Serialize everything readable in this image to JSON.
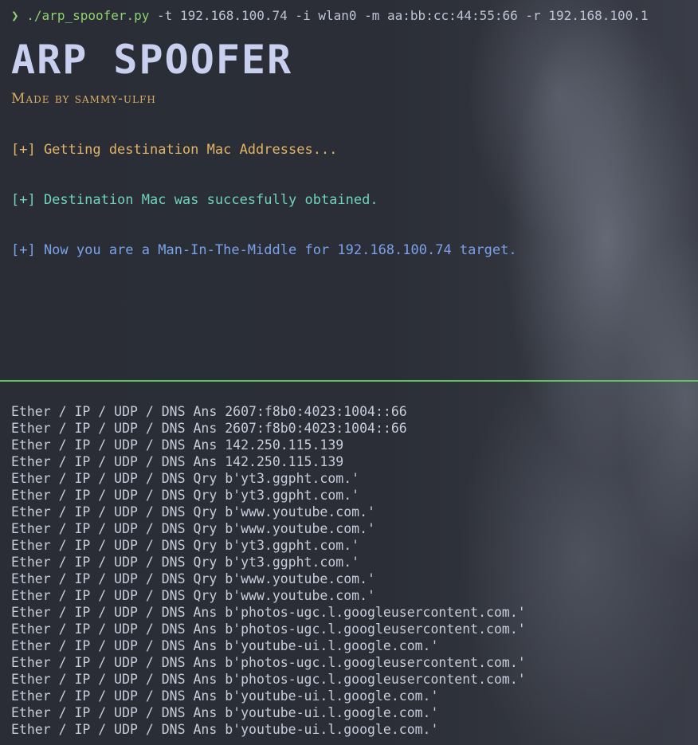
{
  "terminal": {
    "prompt_symbol": "❯",
    "command_script": "./arp_spoofer.py",
    "command_args": " -t 192.168.100.74 -i wlan0 -m aa:bb:cc:44:55:66 -r 192.168.100.1",
    "banner": "ARP SPOOFER",
    "made_by": "Made by sammy-ulfh",
    "messages": [
      "[+] Getting destination Mac Addresses...",
      "[+] Destination Mac was succesfully obtained.",
      "[+] Now you are a Man-In-The-Middle for 192.168.100.74 target."
    ],
    "packets": [
      "Ether / IP / UDP / DNS Ans 2607:f8b0:4023:1004::66",
      "Ether / IP / UDP / DNS Ans 2607:f8b0:4023:1004::66",
      "Ether / IP / UDP / DNS Ans 142.250.115.139",
      "Ether / IP / UDP / DNS Ans 142.250.115.139",
      "Ether / IP / UDP / DNS Qry b'yt3.ggpht.com.'",
      "Ether / IP / UDP / DNS Qry b'yt3.ggpht.com.'",
      "Ether / IP / UDP / DNS Qry b'www.youtube.com.'",
      "Ether / IP / UDP / DNS Qry b'www.youtube.com.'",
      "Ether / IP / UDP / DNS Qry b'yt3.ggpht.com.'",
      "Ether / IP / UDP / DNS Qry b'yt3.ggpht.com.'",
      "Ether / IP / UDP / DNS Qry b'www.youtube.com.'",
      "Ether / IP / UDP / DNS Qry b'www.youtube.com.'",
      "Ether / IP / UDP / DNS Ans b'photos-ugc.l.googleusercontent.com.'",
      "Ether / IP / UDP / DNS Ans b'photos-ugc.l.googleusercontent.com.'",
      "Ether / IP / UDP / DNS Ans b'youtube-ui.l.google.com.'",
      "Ether / IP / UDP / DNS Ans b'photos-ugc.l.googleusercontent.com.'",
      "Ether / IP / UDP / DNS Ans b'photos-ugc.l.googleusercontent.com.'",
      "Ether / IP / UDP / DNS Ans b'youtube-ui.l.google.com.'",
      "Ether / IP / UDP / DNS Ans b'youtube-ui.l.google.com.'",
      "Ether / IP / UDP / DNS Ans b'youtube-ui.l.google.com.'"
    ]
  },
  "colors": {
    "background": "#2a2d35",
    "prompt": "#8fd16f",
    "banner": "#c9cfee",
    "made_by": "#d9ad66",
    "msg_info": "#e2b466",
    "msg_success": "#6fd3bf",
    "msg_mitm": "#7aa2ea",
    "divider": "#58c95a"
  }
}
